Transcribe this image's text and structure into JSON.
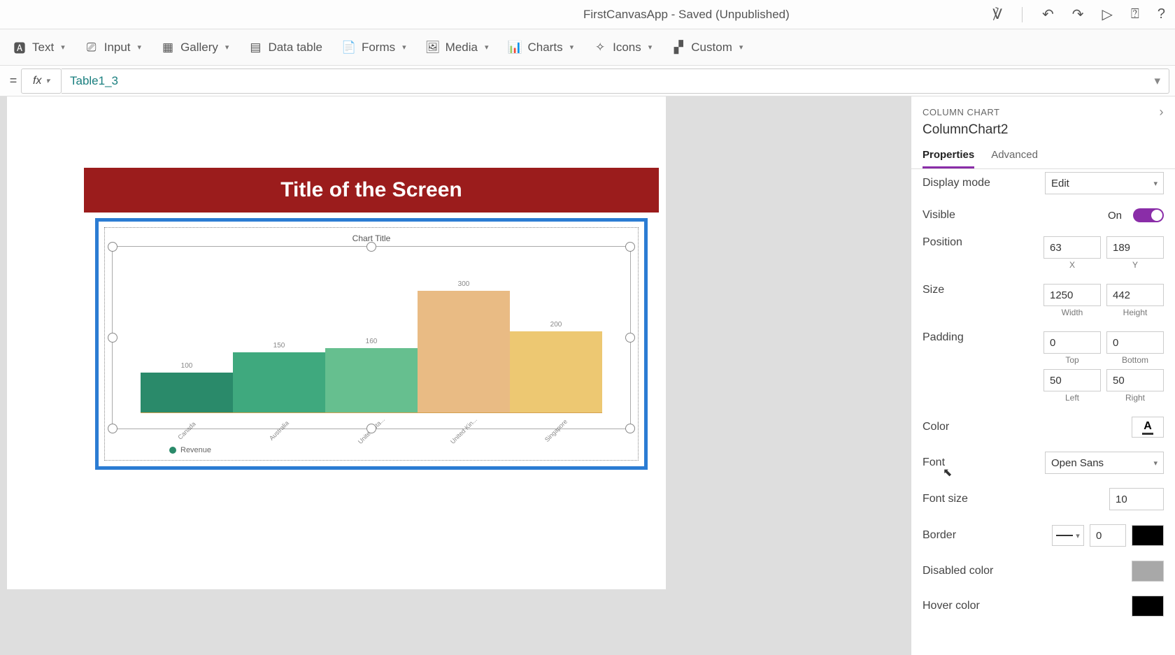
{
  "title_bar": {
    "app_title": "FirstCanvasApp - Saved (Unpublished)"
  },
  "ribbon": {
    "text": "Text",
    "input": "Input",
    "gallery": "Gallery",
    "data_table": "Data table",
    "forms": "Forms",
    "media": "Media",
    "charts": "Charts",
    "icons": "Icons",
    "custom": "Custom"
  },
  "formula": {
    "value": "Table1_3"
  },
  "screen": {
    "title": "Title of the Screen",
    "chart_title": "Chart Title",
    "legend": "Revenue"
  },
  "chart_data": {
    "type": "bar",
    "title": "Chart Title",
    "categories": [
      "Canada",
      "Australia",
      "United Sta...",
      "United Kin...",
      "Singapore"
    ],
    "series": [
      {
        "name": "Revenue",
        "values": [
          100,
          150,
          160,
          300,
          200
        ]
      }
    ],
    "colors": [
      "#2a8a6a",
      "#3fa97e",
      "#66bf8f",
      "#e9bb84",
      "#edc872"
    ],
    "ylim": [
      0,
      300
    ],
    "xlabel": "",
    "ylabel": ""
  },
  "props": {
    "section": "COLUMN CHART",
    "control_name": "ColumnChart2",
    "tab_properties": "Properties",
    "tab_advanced": "Advanced",
    "display_mode_label": "Display mode",
    "display_mode_value": "Edit",
    "visible_label": "Visible",
    "visible_value": "On",
    "position_label": "Position",
    "position_x": "63",
    "position_y": "189",
    "x_label": "X",
    "y_label": "Y",
    "size_label": "Size",
    "size_w": "1250",
    "size_h": "442",
    "w_label": "Width",
    "h_label": "Height",
    "padding_label": "Padding",
    "pad_top": "0",
    "pad_bottom": "0",
    "pad_left": "50",
    "pad_right": "50",
    "top_label": "Top",
    "bottom_label": "Bottom",
    "left_label": "Left",
    "right_label": "Right",
    "color_label": "Color",
    "font_label": "Font",
    "font_value": "Open Sans",
    "font_size_label": "Font size",
    "font_size_value": "10",
    "border_label": "Border",
    "border_value": "0",
    "disabled_color_label": "Disabled color",
    "hover_color_label": "Hover color"
  }
}
